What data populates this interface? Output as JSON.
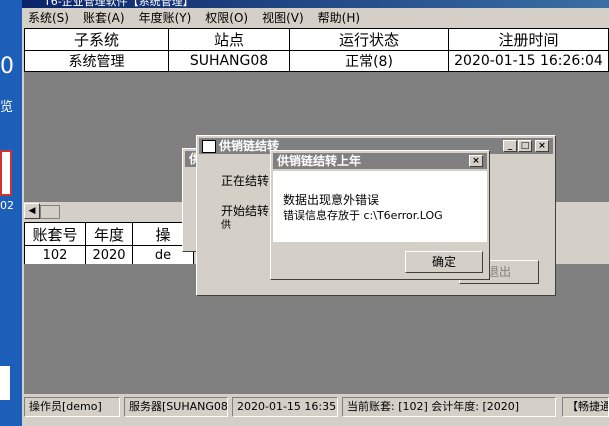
{
  "window_title": "T6-企业管理软件【系统管理】",
  "desktop": {
    "label1": "览",
    "label2": "02"
  },
  "menu": [
    "系统(S)",
    "账套(A)",
    "年度账(Y)",
    "权限(O)",
    "视图(V)",
    "帮助(H)"
  ],
  "subsystems": {
    "headers": [
      "子系统",
      "站点",
      "运行状态",
      "注册时间"
    ],
    "rows": [
      [
        "系统管理",
        "SUHANG08",
        "正常(8)",
        "2020-01-15 16:26:04"
      ]
    ]
  },
  "accounts": {
    "headers": [
      "账套号",
      "年度",
      "操"
    ],
    "rows": [
      [
        "102",
        "2020",
        "de"
      ]
    ]
  },
  "status": {
    "operator": "操作员[demo]",
    "server": "服务器[SUHANG08]",
    "datetime": "2020-01-15 16:35",
    "current": "当前账套: [102] 会计年度: [2020]",
    "right": "【畅捷通"
  },
  "dialog_back": {
    "title": "供",
    "text": "正在结转"
  },
  "dialog_main": {
    "title": "供销链结转",
    "line1": "正在结转",
    "line2": "开始结转",
    "line2b": "供",
    "exit_button": "退出"
  },
  "dialog_msg": {
    "title": "供销链结转上年",
    "line1": "数据出现意外错误",
    "line2": "错误信息存放于 c:\\T6error.LOG",
    "ok_button": "确定"
  }
}
